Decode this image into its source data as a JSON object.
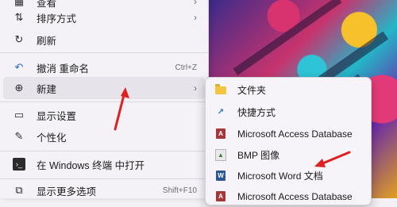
{
  "menu": {
    "items": [
      {
        "label": "查看",
        "shortcut": "",
        "icon": "view-icon",
        "has_submenu": true
      },
      {
        "label": "排序方式",
        "shortcut": "",
        "icon": "sort-icon",
        "has_submenu": true
      },
      {
        "label": "刷新",
        "shortcut": "",
        "icon": "refresh-icon",
        "has_submenu": false
      },
      {
        "label": "撤消 重命名",
        "shortcut": "Ctrl+Z",
        "icon": "undo-icon",
        "has_submenu": false
      },
      {
        "label": "新建",
        "shortcut": "",
        "icon": "new-icon",
        "has_submenu": true
      },
      {
        "label": "显示设置",
        "shortcut": "",
        "icon": "display-settings-icon",
        "has_submenu": false
      },
      {
        "label": "个性化",
        "shortcut": "",
        "icon": "personalize-icon",
        "has_submenu": false
      },
      {
        "label": "在 Windows 终端 中打开",
        "shortcut": "",
        "icon": "terminal-icon",
        "has_submenu": false
      },
      {
        "label": "显示更多选项",
        "shortcut": "Shift+F10",
        "icon": "more-options-icon",
        "has_submenu": false
      }
    ]
  },
  "submenu": {
    "items": [
      {
        "label": "文件夹",
        "icon": "folder-icon"
      },
      {
        "label": "快捷方式",
        "icon": "shortcut-icon"
      },
      {
        "label": "Microsoft Access Database",
        "icon": "access-icon"
      },
      {
        "label": "BMP 图像",
        "icon": "bmp-icon"
      },
      {
        "label": "Microsoft Word 文档",
        "icon": "word-icon"
      },
      {
        "label": "Microsoft Access Database",
        "icon": "access-icon"
      }
    ]
  },
  "colors": {
    "annotation_arrow": "#e02020",
    "hover": "#e6e3ea"
  }
}
